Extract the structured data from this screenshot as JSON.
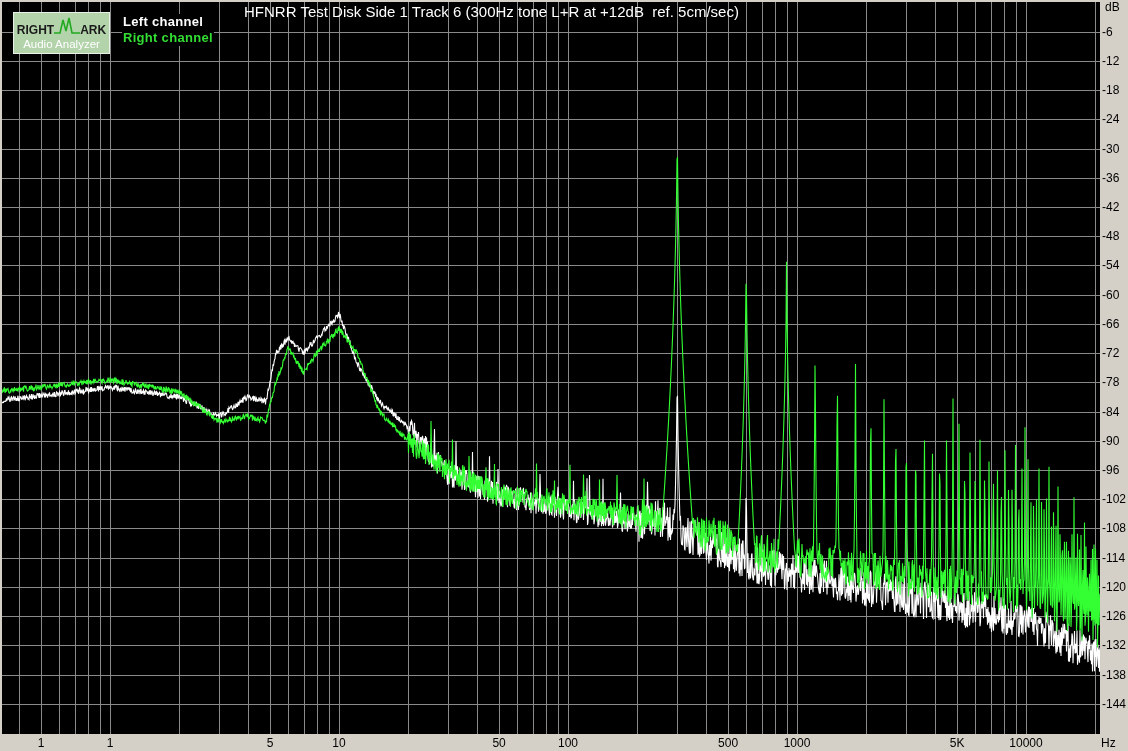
{
  "title": "HFNRR Test Disk Side 1 Track 6 (300Hz tone L+R at +12dB  ref. 5cm/sec)",
  "logo": {
    "word_1": "RIGHT",
    "word_2": "ARK",
    "subtitle": "Audio Analyzer"
  },
  "legend": [
    {
      "label": "Left channel",
      "color": "#ffffff"
    },
    {
      "label": "Right channel",
      "color": "#33dd33"
    }
  ],
  "y_axis": {
    "unit": "dB",
    "ticks": [
      "-6",
      "-12",
      "-18",
      "-24",
      "-30",
      "-36",
      "-42",
      "-48",
      "-54",
      "-60",
      "-66",
      "-72",
      "-78",
      "-84",
      "-90",
      "-96",
      "-102",
      "-108",
      "-114",
      "-120",
      "-126",
      "-132",
      "-138",
      "-144"
    ]
  },
  "x_axis": {
    "unit": "Hz",
    "ticks": [
      "1",
      "1",
      "5",
      "10",
      "50",
      "100",
      "500",
      "1000",
      "5K",
      "10000"
    ]
  }
}
